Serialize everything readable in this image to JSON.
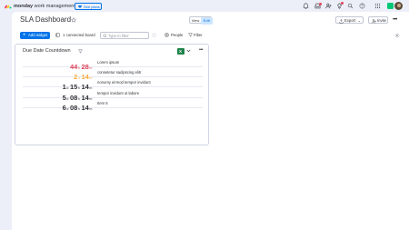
{
  "app": {
    "brand_bold": "monday",
    "brand_rest": " work management",
    "see_plans_label": "See plans"
  },
  "board": {
    "title": "SLA Dashboard",
    "view_label": "View",
    "edit_label": "Edit",
    "export_label": "Export",
    "invite_label": "Invite"
  },
  "toolbar": {
    "add_widget_label": "Add widget",
    "connected_label": "1 connected board",
    "search_placeholder": "Type to filter",
    "people_label": "People",
    "filter_label": "Filter"
  },
  "widget": {
    "title": "Due Date Countdown",
    "units": {
      "d": "d",
      "h": "h",
      "m": "m"
    },
    "rows": [
      {
        "d": "",
        "h": "44",
        "m": "28",
        "name": "Lorem ipsum",
        "color": "#e2445c"
      },
      {
        "d": "",
        "h": "2",
        "m": "14",
        "name": "consetetur sadipscing elitr",
        "color": "#fdab3d"
      },
      {
        "d": "1",
        "h": "15",
        "m": "14",
        "name": "nonumy eirmod tempor invidunt",
        "color": "#323338"
      },
      {
        "d": "5",
        "h": "08",
        "m": "14",
        "name": "tempor invidunt ut labore",
        "color": "#323338"
      },
      {
        "d": "6",
        "h": "08",
        "m": "14",
        "name": "Item 5",
        "color": "#323338"
      }
    ]
  },
  "colors": {
    "accent": "#0073ea",
    "danger": "#e2445c",
    "warning": "#fdab3d",
    "success": "#00c875",
    "background": "#eceff8"
  },
  "icons": [
    "monday-logo-icon",
    "star-icon",
    "bell-icon",
    "inbox-icon",
    "invite-members-icon",
    "apps-icon",
    "search-icon",
    "help-icon",
    "grid-icon",
    "export-icon",
    "invite-icon",
    "more-icon",
    "board-icon",
    "search-icon",
    "filter-icon",
    "person-icon",
    "settings-icon",
    "excel-icon",
    "chevron-down-icon"
  ]
}
